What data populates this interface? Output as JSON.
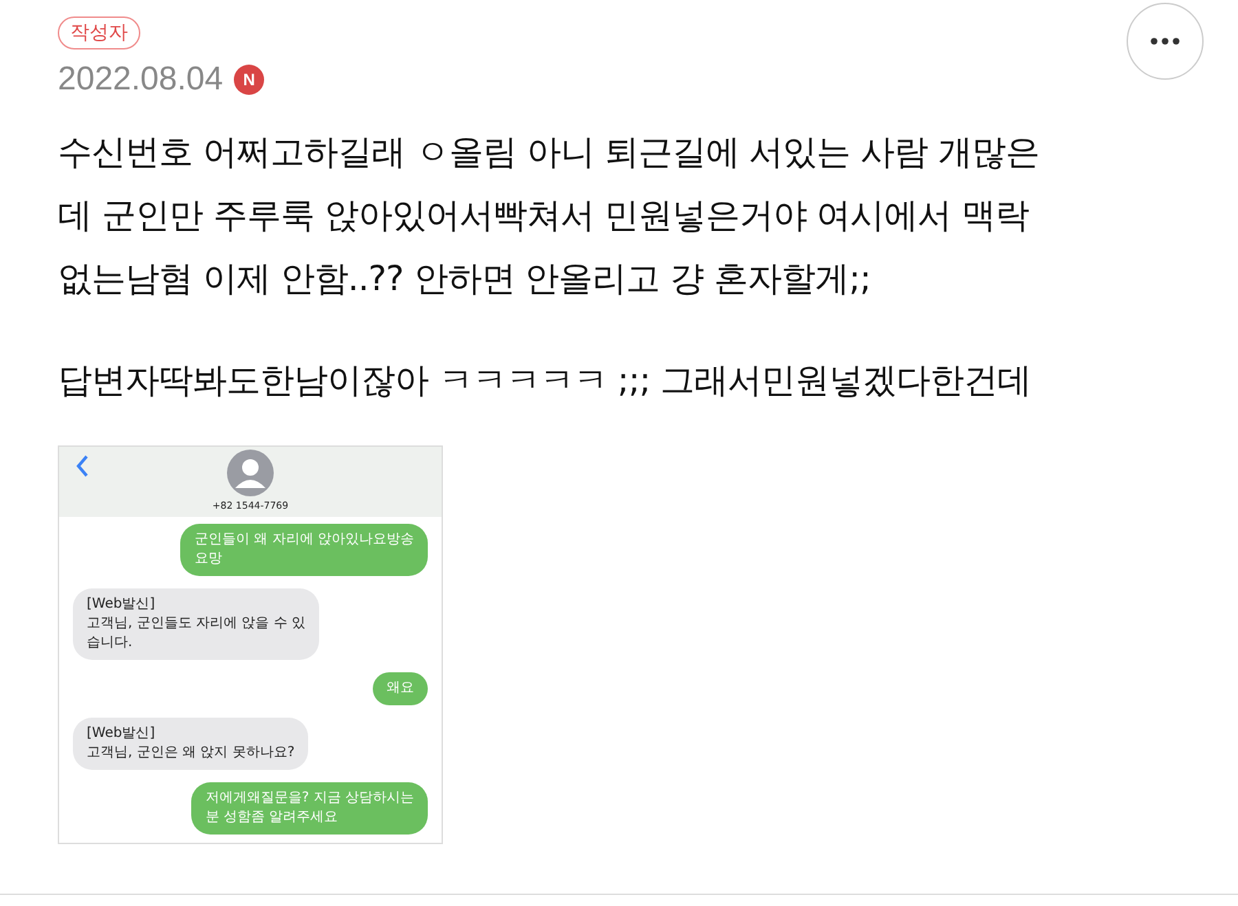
{
  "author_badge": "작성자",
  "date": "2022.08.04",
  "new_badge": "N",
  "post_paragraphs": [
    [
      "수신번호 어쩌고하길래 ㅇ올림 아니 퇴근길에 서있는 사람 개많은",
      "데 군인만 주루룩 앉아있어서빡쳐서 민원넣은거야 여시에서 맥락",
      "없는남혐 이제 안함..?? 안하면 안올리고 걍 혼자할게;;"
    ],
    [
      "답변자딱봐도한남이잖아 ㅋㅋㅋㅋㅋ ;;; 그래서민원넣겠다한건데"
    ]
  ],
  "screenshot": {
    "contact": "+82 1544-7769",
    "messages": [
      {
        "kind": "sent",
        "lines": [
          "군인들이 왜 자리에 앉아있나요방송",
          "요망"
        ]
      },
      {
        "kind": "received",
        "lines": [
          "[Web발신]",
          "고객님, 군인들도 자리에 앉을 수 있",
          "습니다."
        ]
      },
      {
        "kind": "sent",
        "lines": [
          "왜요"
        ]
      },
      {
        "kind": "received",
        "lines": [
          "[Web발신]",
          "고객님, 군인은 왜 앉지 못하나요?"
        ]
      },
      {
        "kind": "sent",
        "lines": [
          "저에게왜질문을? 지금 상담하시는",
          "분 성함좀 알려주세요"
        ]
      }
    ]
  }
}
